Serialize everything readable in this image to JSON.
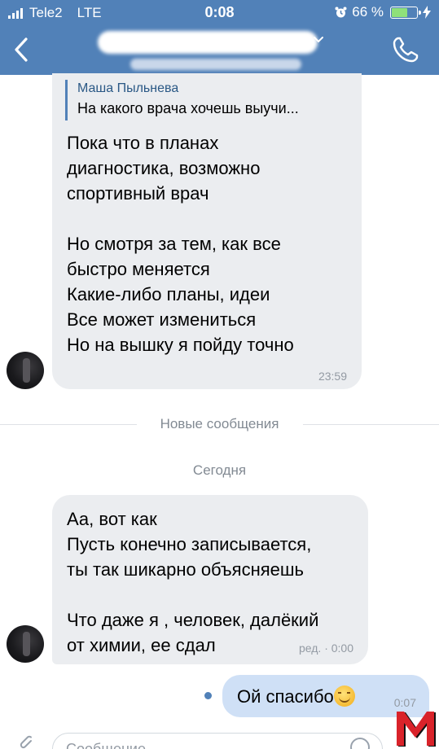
{
  "status_bar": {
    "carrier": "Tele2",
    "network": "LTE",
    "time": "0:08",
    "battery_percent": "66 %",
    "battery_level": 0.66
  },
  "header": {
    "back_icon": "chevron-left-icon",
    "call_icon": "phone-icon",
    "title_chevron_icon": "chevron-down-icon"
  },
  "messages": [
    {
      "reply": {
        "author": "Маша Пыльнева",
        "text": "На какого врача хочешь выучи..."
      },
      "text": "Пока что в планах\nдиагностика, возможно\nспортивный врач\n\nНо смотря за тем, как все\nбыстро меняется\nКакие-либо планы, идеи\nВсе может измениться\nНо на вышку я пойду точно",
      "time": "23:59"
    },
    {
      "text": "Аа, вот как\nПусть конечно записывается,\nты так шикарно объясняешь\n\nЧто даже я , человек, далёкий\nот химии, ее сдал",
      "time": "ред. · 0:00"
    },
    {
      "text": "Ой спасибо",
      "emoji_icon": "smiling-face-emoji-icon",
      "time": "0:07"
    }
  ],
  "dividers": {
    "new_messages": "Новые сообщения",
    "today": "Сегодня"
  },
  "composer": {
    "placeholder": "Сообщение",
    "attach_icon": "paperclip-icon",
    "sticker_icon": "sticker-icon"
  },
  "colors": {
    "header": "#5181b8",
    "incoming_bubble": "#ebedf0",
    "outgoing_bubble": "#cfe0f6",
    "watermark_red": "#d9232a"
  }
}
